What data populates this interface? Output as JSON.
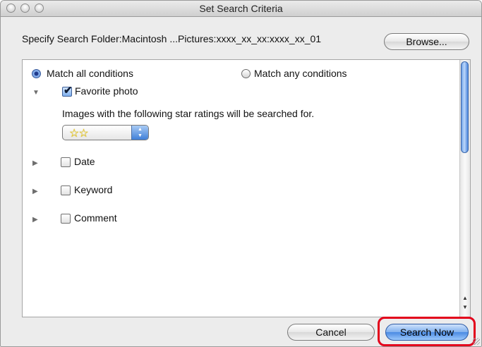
{
  "window": {
    "title": "Set Search Criteria"
  },
  "search_folder": {
    "label": "Specify Search Folder:Macintosh ...Pictures:xxxx_xx_xx:xxxx_xx_01",
    "browse_label": "Browse..."
  },
  "match": {
    "all_label": "Match all conditions",
    "any_label": "Match any conditions",
    "selected": "all"
  },
  "criteria": {
    "favorite": {
      "label": "Favorite photo",
      "checked": true,
      "expanded": true,
      "description": "Images with the following star ratings will be searched for.",
      "rating_value": "☆☆",
      "rating_stars": 2
    },
    "date": {
      "label": "Date",
      "checked": false,
      "expanded": false
    },
    "keyword": {
      "label": "Keyword",
      "checked": false,
      "expanded": false
    },
    "comment": {
      "label": "Comment",
      "checked": false,
      "expanded": false
    }
  },
  "icons": {
    "expanded_triangle": "▼",
    "collapsed_triangle": "▶",
    "checkmark": "✔",
    "scroll_up": "▲",
    "scroll_down": "▼"
  },
  "buttons": {
    "cancel_label": "Cancel",
    "search_now_label": "Search Now"
  },
  "colors": {
    "highlight_border": "#e3001b",
    "accent_blue": "#4a8ae3"
  }
}
